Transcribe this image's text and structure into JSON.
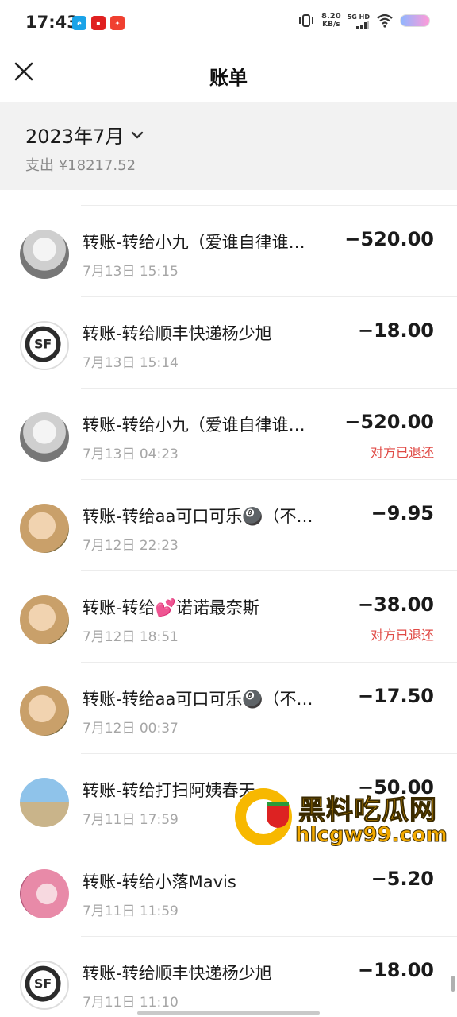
{
  "status": {
    "time": "17:43",
    "net_speed_value": "8.20",
    "net_speed_unit": "KB/s",
    "signal": "5G HD"
  },
  "nav": {
    "title": "账单"
  },
  "summary": {
    "month": "2023年7月",
    "expense": "支出 ¥18217.52"
  },
  "transactions": [
    {
      "title": "转账-转给小九（爱谁自律谁…",
      "date": "7月13日 15:15",
      "amount": "−520.00",
      "note": "",
      "avatar_icon": "anime-girl-avatar"
    },
    {
      "title": "转账-转给顺丰快递杨少旭",
      "date": "7月13日 15:14",
      "amount": "−18.00",
      "note": "",
      "avatar_icon": "sf-express-logo"
    },
    {
      "title": "转账-转给小九（爱谁自律谁…",
      "date": "7月13日 04:23",
      "amount": "−520.00",
      "note": "对方已退还",
      "avatar_icon": "anime-girl-avatar"
    },
    {
      "title": "转账-转给aa可口可乐🎱（不…",
      "date": "7月12日 22:23",
      "amount": "−9.95",
      "note": "",
      "avatar_icon": "photo-avatar"
    },
    {
      "title": "转账-转给💕诺诺最奈斯",
      "date": "7月12日 18:51",
      "amount": "−38.00",
      "note": "对方已退还",
      "avatar_icon": "photo-avatar"
    },
    {
      "title": "转账-转给aa可口可乐🎱（不…",
      "date": "7月12日 00:37",
      "amount": "−17.50",
      "note": "",
      "avatar_icon": "photo-avatar"
    },
    {
      "title": "转账-转给打扫阿姨春天",
      "date": "7月11日 17:59",
      "amount": "−50.00",
      "note": "",
      "avatar_icon": "beach-avatar"
    },
    {
      "title": "转账-转给小落Mavis",
      "date": "7月11日 11:59",
      "amount": "−5.20",
      "note": "",
      "avatar_icon": "pink-hair-avatar"
    },
    {
      "title": "转账-转给顺丰快递杨少旭",
      "date": "7月11日 11:10",
      "amount": "−18.00",
      "note": "",
      "avatar_icon": "sf-express-logo"
    }
  ],
  "watermark": {
    "line1": "黑料吃瓜网",
    "line2": "hlcgw99.com"
  },
  "colors": {
    "refund_note": "#e04a45",
    "summary_bg": "#f2f2f2",
    "date_gray": "#a6a6a6"
  }
}
